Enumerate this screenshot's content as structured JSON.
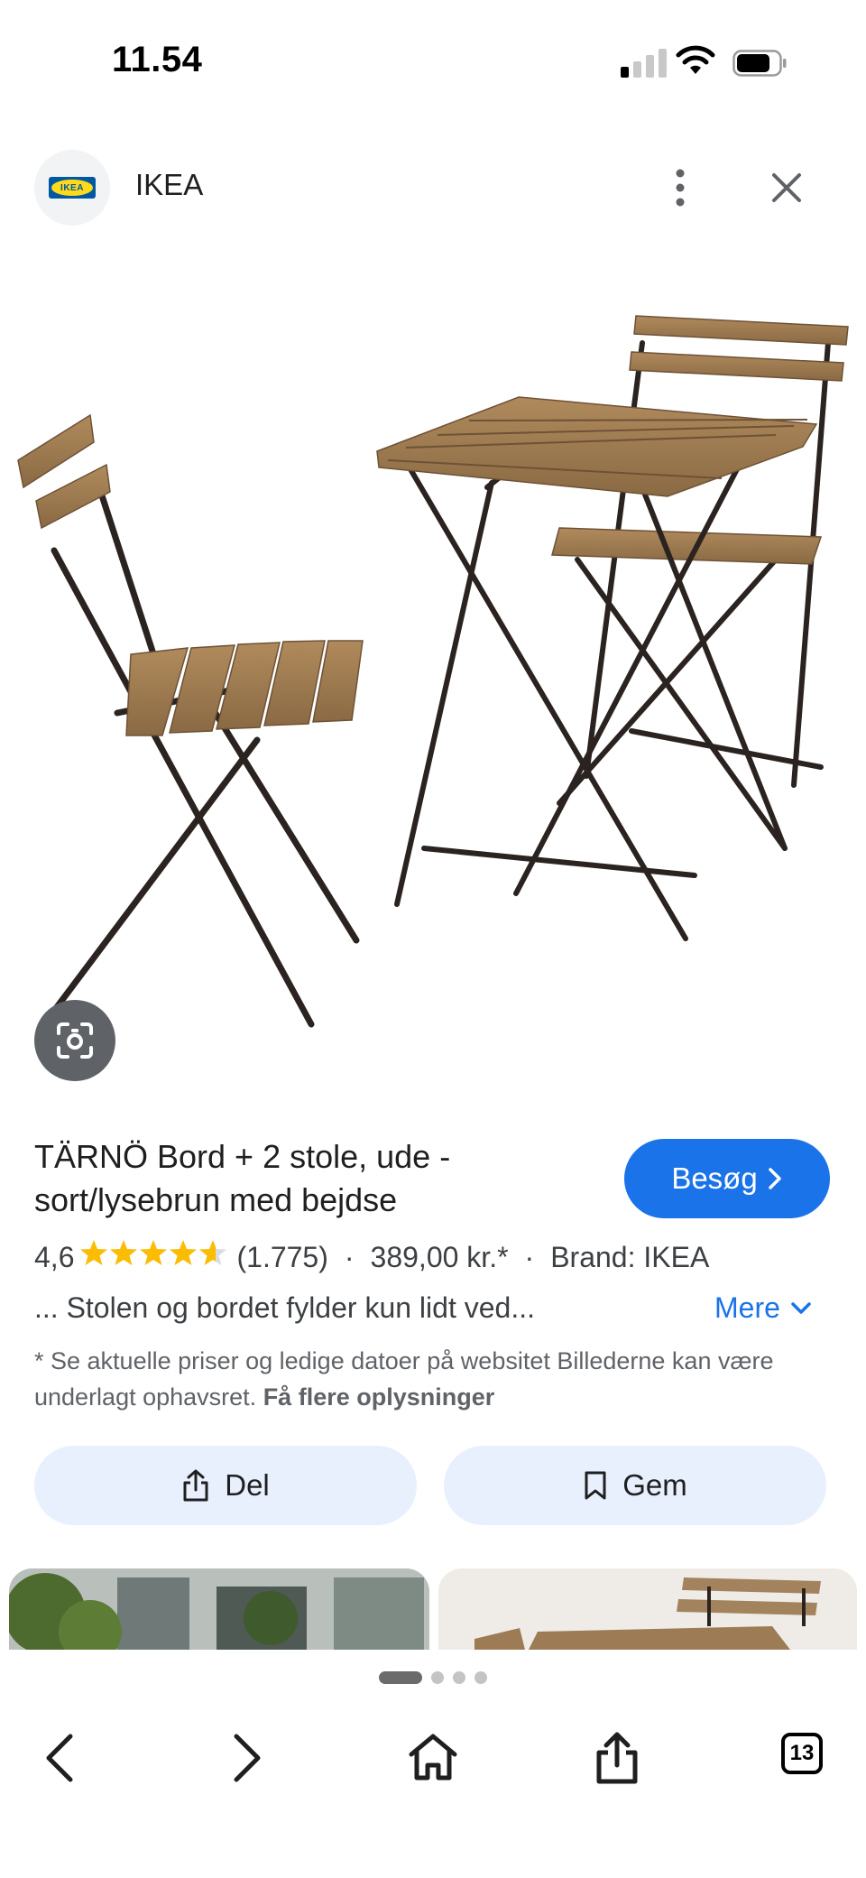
{
  "status_bar": {
    "time": "11.54"
  },
  "header": {
    "site_name": "IKEA",
    "logo_text": "IKEA"
  },
  "product": {
    "title": "TÄRNÖ Bord + 2 stole, ude - sort/lysebrun med bejdse",
    "visit_label": "Besøg",
    "rating": "4,6",
    "stars": "★★★★★",
    "rating_fraction": 0.92,
    "reviews": "(1.775)",
    "separator": "·",
    "price": "389,00 kr.*",
    "brand": "Brand: IKEA",
    "description": "... Stolen og bordet fylder kun lidt ved...",
    "more_label": "Mere",
    "disclaimer": "* Se aktuelle priser og ledige datoer på websitet Billederne kan være underlagt ophavsret.",
    "more_info_link": "Få flere oplysninger"
  },
  "actions": {
    "share_label": "Del",
    "save_label": "Gem"
  },
  "bottom_bar": {
    "tabs_count": "13"
  },
  "colors": {
    "accent": "#1a73e8",
    "pill_bg": "#e8f0fe",
    "star": "#fbbc04"
  },
  "icons": [
    "signal-icon",
    "wifi-icon",
    "battery-icon",
    "more-options-icon",
    "close-icon",
    "google-lens-icon",
    "chevron-right-icon",
    "chevron-down-icon",
    "share-icon",
    "bookmark-icon",
    "back-icon",
    "forward-icon",
    "home-icon",
    "share-sheet-icon",
    "tabs-icon"
  ]
}
